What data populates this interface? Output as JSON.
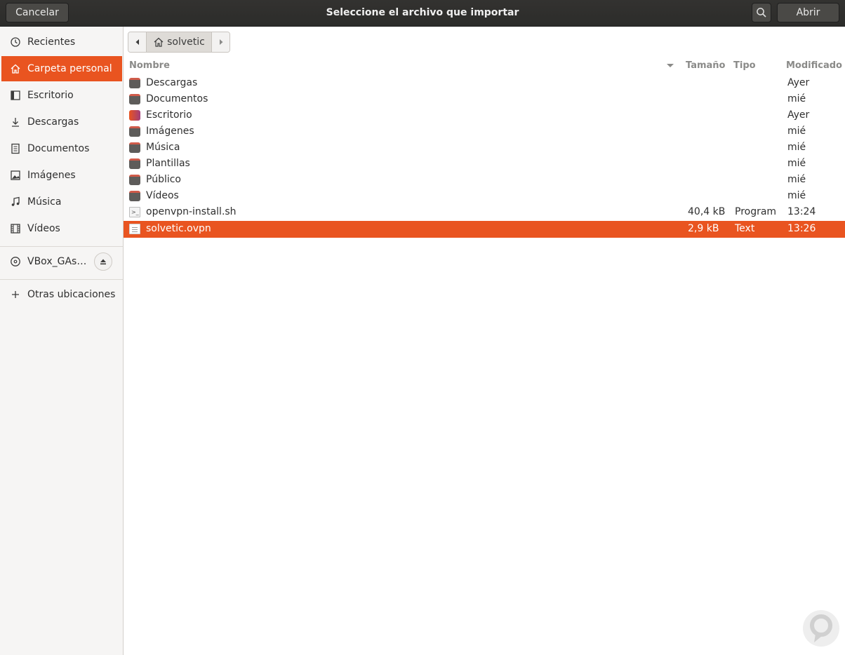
{
  "header": {
    "title": "Seleccione el archivo que importar",
    "cancel_label": "Cancelar",
    "open_label": "Abrir"
  },
  "sidebar": {
    "items": [
      {
        "label": "Recientes",
        "icon": "clock-icon"
      },
      {
        "label": "Carpeta personal",
        "icon": "home-icon",
        "active": true
      },
      {
        "label": "Escritorio",
        "icon": "desktop-icon"
      },
      {
        "label": "Descargas",
        "icon": "download-icon"
      },
      {
        "label": "Documentos",
        "icon": "document-icon"
      },
      {
        "label": "Imágenes",
        "icon": "image-icon"
      },
      {
        "label": "Música",
        "icon": "music-icon"
      },
      {
        "label": "Vídeos",
        "icon": "video-icon"
      }
    ],
    "device": {
      "label": "VBox_GAs…",
      "icon": "disc-icon"
    },
    "other": {
      "label": "Otras ubicaciones",
      "icon": "plus-icon"
    }
  },
  "pathbar": {
    "crumb": "solvetic"
  },
  "columns": {
    "name": "Nombre",
    "size": "Tamaño",
    "type": "Tipo",
    "modified": "Modificado"
  },
  "files": [
    {
      "name": "Descargas",
      "size": "",
      "type": "",
      "modified": "Ayer",
      "icon": "folder-icon"
    },
    {
      "name": "Documentos",
      "size": "",
      "type": "",
      "modified": "mié",
      "icon": "folder-icon"
    },
    {
      "name": "Escritorio",
      "size": "",
      "type": "",
      "modified": "Ayer",
      "icon": "desktop-folder-icon"
    },
    {
      "name": "Imágenes",
      "size": "",
      "type": "",
      "modified": "mié",
      "icon": "folder-icon"
    },
    {
      "name": "Música",
      "size": "",
      "type": "",
      "modified": "mié",
      "icon": "folder-icon"
    },
    {
      "name": "Plantillas",
      "size": "",
      "type": "",
      "modified": "mié",
      "icon": "folder-icon"
    },
    {
      "name": "Público",
      "size": "",
      "type": "",
      "modified": "mié",
      "icon": "folder-icon"
    },
    {
      "name": "Vídeos",
      "size": "",
      "type": "",
      "modified": "mié",
      "icon": "folder-icon"
    },
    {
      "name": "openvpn-install.sh",
      "size": "40,4 kB",
      "type": "Program",
      "modified": "13:24",
      "icon": "script-file-icon"
    },
    {
      "name": "solvetic.ovpn",
      "size": "2,9 kB",
      "type": "Text",
      "modified": "13:26",
      "icon": "text-file-icon",
      "selected": true
    }
  ],
  "colors": {
    "accent": "#e95420",
    "headerbar": "#2f2f2d"
  }
}
